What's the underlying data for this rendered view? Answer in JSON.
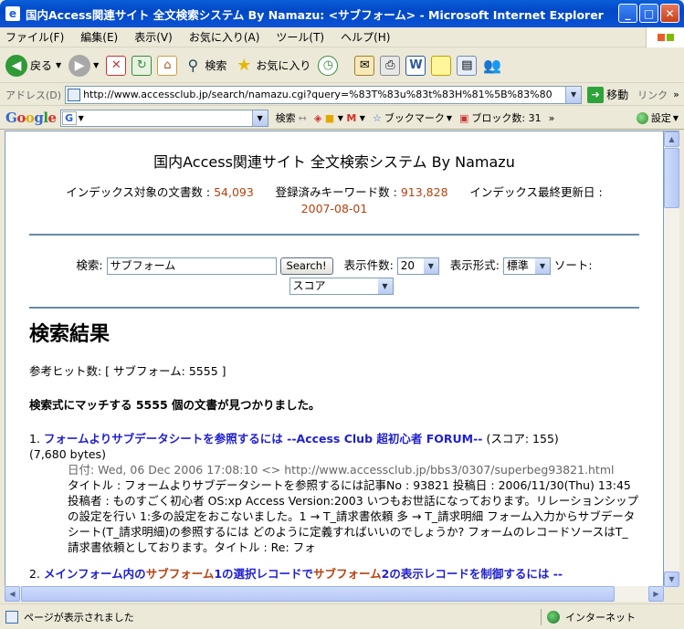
{
  "window": {
    "title": "国内Access関連サイト 全文検索システム By Namazu: <サブフォーム> - Microsoft Internet Explorer",
    "min": "_",
    "max": "□",
    "close": "✕"
  },
  "menu": [
    "ファイル(F)",
    "編集(E)",
    "表示(V)",
    "お気に入り(A)",
    "ツール(T)",
    "ヘルプ(H)"
  ],
  "toolbar": {
    "back": "戻る",
    "search": "検索",
    "favorites": "お気に入り"
  },
  "address": {
    "label": "アドレス(D)",
    "url": "http://www.accessclub.jp/search/namazu.cgi?query=%83T%83u%83t%83H%81%5B%83%80",
    "go": "移動",
    "links": "リンク"
  },
  "google": {
    "logo": "Google",
    "search": "検索",
    "bookmarks": "ブックマーク",
    "blocked": "ブロック数: 31",
    "settings": "設定"
  },
  "page": {
    "title": "国内Access関連サイト 全文検索システム By Namazu",
    "docs_label": "インデックス対象の文書数 : ",
    "docs": "54,093",
    "keywords_label": "登録済みキーワード数 : ",
    "keywords": "913,828",
    "updated_label": "インデックス最終更新日 : ",
    "updated": "2007-08-01",
    "search_label": "検索:",
    "query": "サブフォーム",
    "search_button": "Search!",
    "count_label": "表示件数:",
    "count": "20",
    "format_label": "表示形式:",
    "format": "標準",
    "sort_label": "ソート:",
    "sort": "スコア",
    "results_heading": "検索結果",
    "hits": "参考ヒット数: [ サブフォーム: 5555 ]",
    "matched": "検索式にマッチする 5555 個の文書が見つかりました。",
    "r1": {
      "num": "1.",
      "title": "フォームよりサブデータシートを参照するには --Access Club 超初心者 FORUM--",
      "score": "(スコア: 155)",
      "size": "(7,680 bytes)",
      "meta": "日付: Wed, 06 Dec 2006 17:08:10 <> http://www.accessclub.jp/bbs3/0307/superbeg93821.html",
      "body": "タイトル : フォームよりサブデータシートを参照するには記事No : 93821 投稿日 : 2006/11/30(Thu) 13:45 投稿者 : ものすごく初心者 OS:xp Access Version:2003 いつもお世話になっております。リレーションシップの設定を行い 1:多の設定をおこないました。1 → T_請求書依頼 多 → T_請求明細 フォーム入力からサブデータシート(T_請求明細)の参照するには どのように定義すればいいのでしょうか? フォームのレコードソースはT_請求書依頼としております。タイトル : Re: フォ"
    },
    "r2": {
      "num": "2.",
      "t1": "メインフォーム内の",
      "t2": "サブフォーム",
      "t3": "1の選択レコードで",
      "t4": "サブフォーム",
      "t5": "2の表示レコードを制御するには --"
    }
  },
  "status": {
    "text": "ページが表示されました",
    "zone": "インターネット"
  }
}
